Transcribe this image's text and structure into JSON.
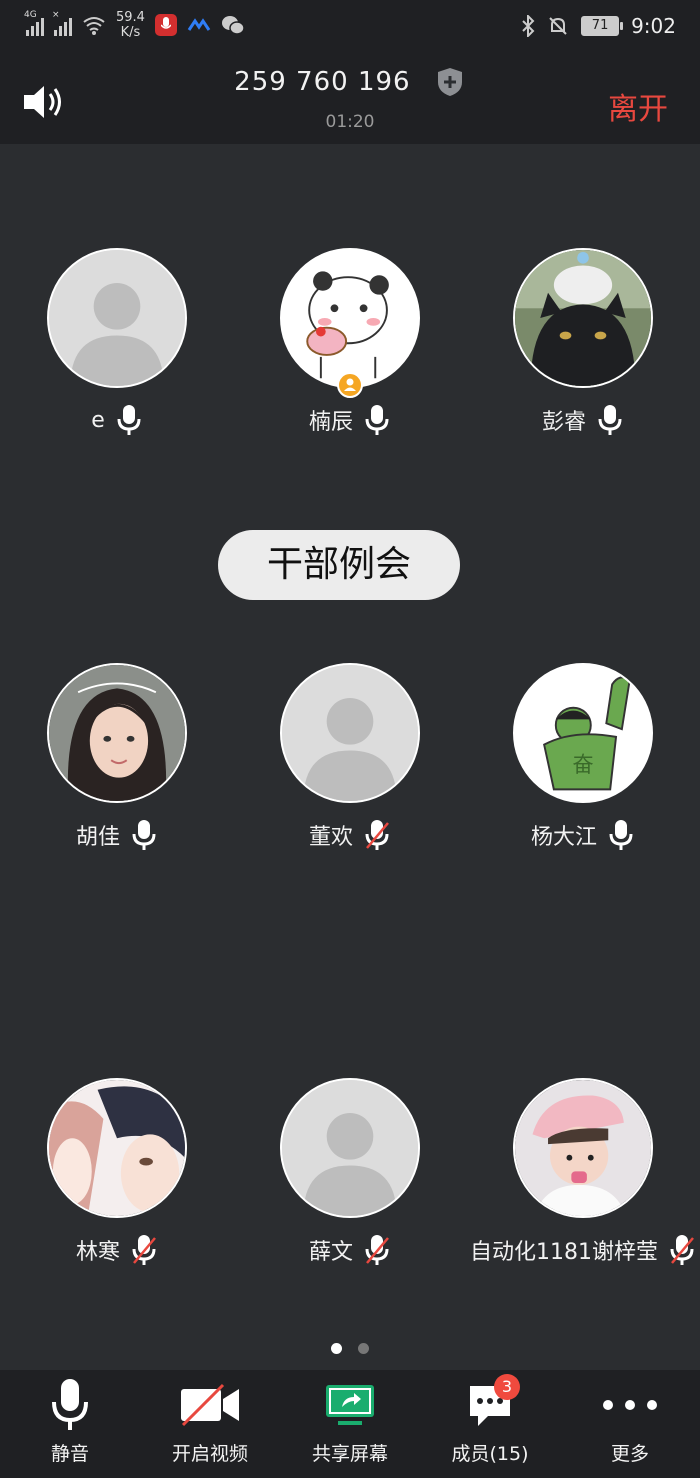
{
  "status_bar": {
    "network_1": "4G",
    "speed_value": "59.4",
    "speed_unit": "K/s",
    "battery": "71",
    "time": "9:02"
  },
  "header": {
    "meeting_id": "259 760 196",
    "duration": "01:20",
    "leave_label": "离开"
  },
  "meeting_topic": "干部例会",
  "participants": [
    {
      "name": "e",
      "mic_muted": false,
      "avatar": "default",
      "host": false
    },
    {
      "name": "楠辰",
      "mic_muted": false,
      "avatar": "panda-sticker",
      "host": true
    },
    {
      "name": "彭睿",
      "mic_muted": false,
      "avatar": "cats-photo",
      "host": false
    },
    {
      "name": "胡佳",
      "mic_muted": false,
      "avatar": "woman-photo",
      "host": false
    },
    {
      "name": "董欢",
      "mic_muted": true,
      "avatar": "default",
      "host": false
    },
    {
      "name": "杨大江",
      "mic_muted": false,
      "avatar": "hulk-sticker",
      "host": false
    },
    {
      "name": "林寒",
      "mic_muted": true,
      "avatar": "anime-couple",
      "host": false
    },
    {
      "name": "薛文",
      "mic_muted": true,
      "avatar": "default",
      "host": false
    },
    {
      "name": "自动化1181谢梓莹",
      "mic_muted": true,
      "avatar": "child-photo",
      "host": false
    }
  ],
  "pagination": {
    "pages": 2,
    "current": 1
  },
  "toolbar": {
    "mute_label": "静音",
    "video_label": "开启视频",
    "share_label": "共享屏幕",
    "members_label": "成员(15)",
    "members_badge": "3",
    "more_label": "更多"
  },
  "colors": {
    "leave": "#e8483f",
    "share_green": "#1aad6e",
    "badge": "#f04a3e",
    "mic_muted_slash": "#e8483f"
  }
}
